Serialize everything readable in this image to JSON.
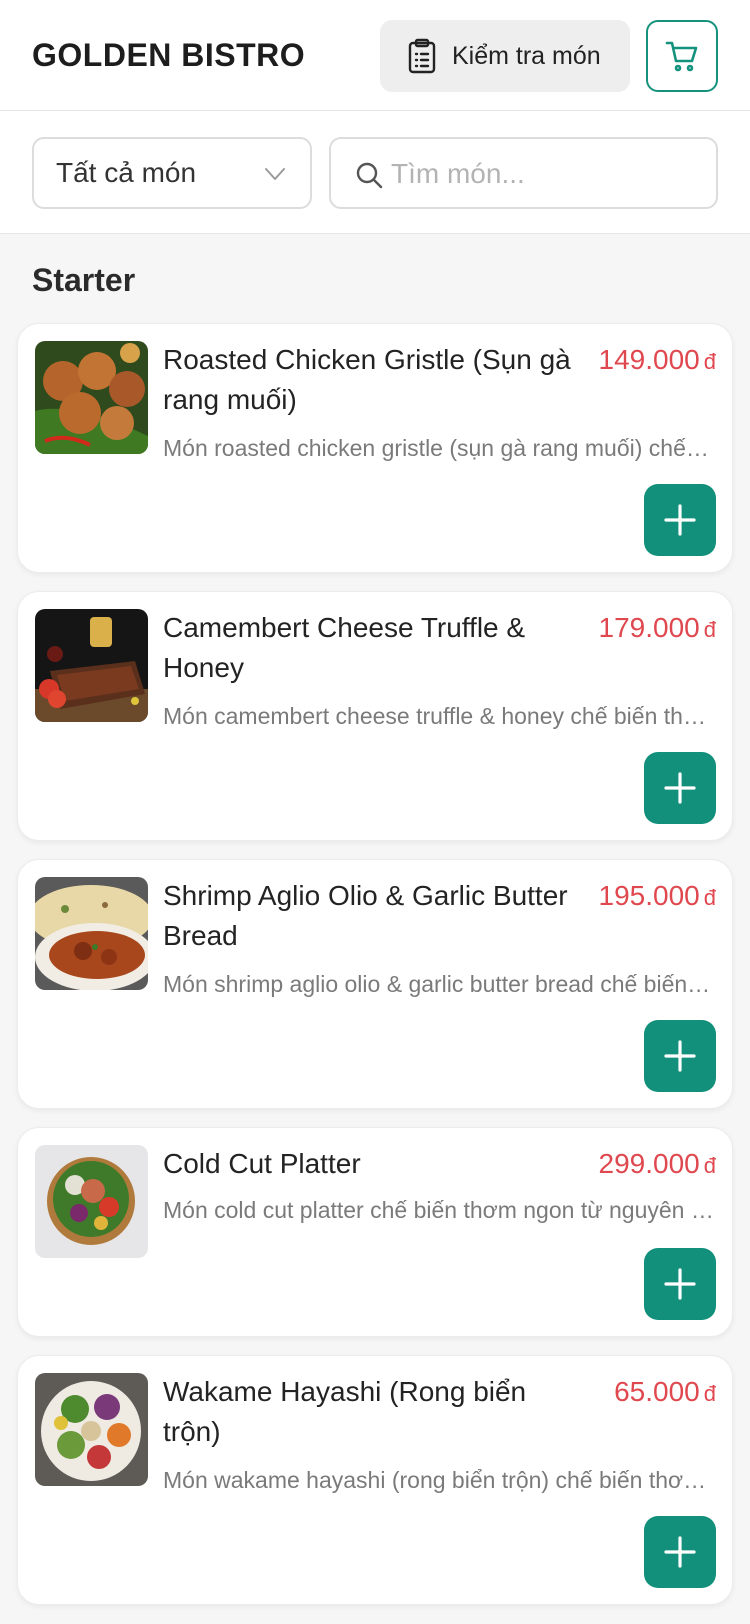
{
  "header": {
    "brand": "GOLDEN BISTRO",
    "check_order_label": "Kiểm tra món"
  },
  "filters": {
    "category_selected": "Tất cả món",
    "search_placeholder": "Tìm món..."
  },
  "section": {
    "title": "Starter"
  },
  "items": [
    {
      "name": "Roasted Chicken Gristle (Sụn gà rang muối)",
      "price": "149.000",
      "currency": "đ",
      "description": "Món roasted chicken gristle (sụn gà rang muối) chế biến thơm ngon",
      "image": "fried-chicken-photo"
    },
    {
      "name": "Camembert Cheese Truffle & Honey",
      "price": "179.000",
      "currency": "đ",
      "description": "Món camembert cheese truffle & honey chế biến thơm ngon",
      "image": "ribs-platter-photo"
    },
    {
      "name": "Shrimp Aglio Olio & Garlic Butter Bread",
      "price": "195.000",
      "currency": "đ",
      "description": "Món shrimp aglio olio & garlic butter bread chế biến thơm ngon",
      "image": "curry-naan-photo"
    },
    {
      "name": "Cold Cut Platter",
      "price": "299.000",
      "currency": "đ",
      "description": "Món cold cut platter chế biến thơm ngon từ nguyên liệu tươi",
      "image": "salad-bowl-photo"
    },
    {
      "name": "Wakame Hayashi (Rong biển trộn)",
      "price": "65.000",
      "currency": "đ",
      "description": "Món wakame hayashi (rong biển trộn) chế biến thơm ngon",
      "image": "veggie-bowl-photo"
    }
  ],
  "colors": {
    "accent": "#13907c",
    "price": "#e0484f"
  }
}
